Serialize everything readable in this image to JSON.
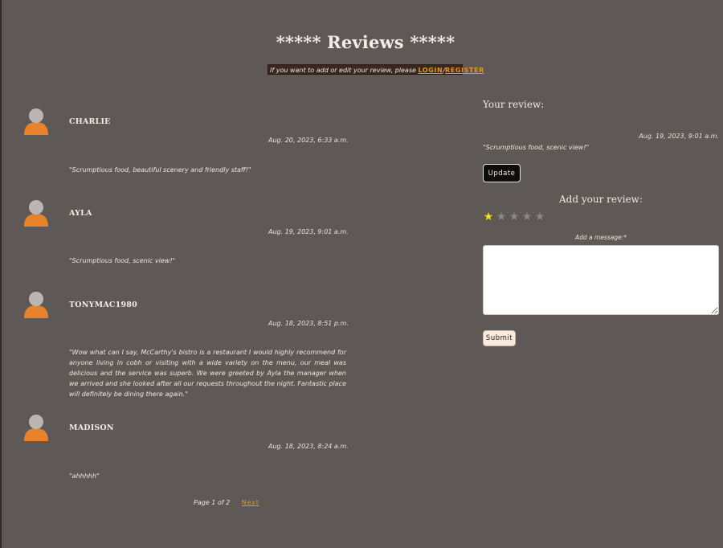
{
  "page": {
    "title": "***** Reviews *****",
    "login_prompt": {
      "text": "If you want to add or edit your review, please ",
      "login_label": "LOGIN",
      "separator": "/",
      "register_label": "REGISTER"
    }
  },
  "reviews": [
    {
      "username": "CHARLIE",
      "date": "Aug. 20, 2023, 6:33 a.m.",
      "message": "\"Scrumptious food, beautiful scenery and friendly staff!\""
    },
    {
      "username": "AYLA",
      "date": "Aug. 19, 2023, 9:01 a.m.",
      "message": "\"Scrumptious food, scenic view!\""
    },
    {
      "username": "TONYMAC1980",
      "date": "Aug. 18, 2023, 8:51 p.m.",
      "message": "\"Wow what can I say, McCarthy's bistro is a restaurant I would highly recommend for anyone living in cobh or visiting with a wide variety on the menu, our meal was delicious and the service was superb. We were greeted by Ayla the manager when we arrived and she looked after all our requests throughout the night. Fantastic place will definitely be dining there again.\""
    },
    {
      "username": "MADISON",
      "date": "Aug. 18, 2023, 8:24 a.m.",
      "message": "\"ahhhhh\""
    }
  ],
  "pagination": {
    "page_text": "Page 1 of 2",
    "next_label": "Next"
  },
  "your_review": {
    "heading": "Your review:",
    "date": "Aug. 19, 2023, 9:01 a.m.",
    "message": "\"Scrumptious food, scenic view!\"",
    "update_label": "Update"
  },
  "add_review": {
    "heading": "Add your review:",
    "rating": 1,
    "max_rating": 5,
    "star_glyph": "★",
    "star_active_color": "#f3e21a",
    "star_inactive_color": "#8c8784",
    "message_label": "Add a message:*",
    "message_value": "",
    "submit_label": "Submit"
  },
  "colors": {
    "background": "#5e5856",
    "link": "#e9951f",
    "avatar_head": "#b9b6b4",
    "avatar_body": "#e8832c"
  }
}
